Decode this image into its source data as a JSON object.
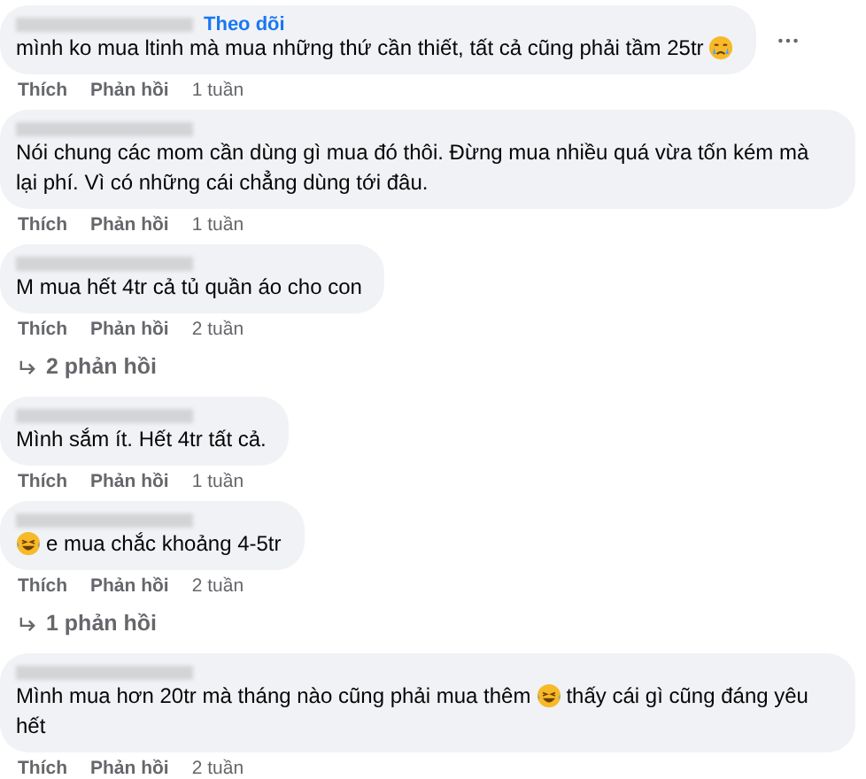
{
  "comments": [
    {
      "follow": "Theo dõi",
      "segments": [
        {
          "kind": "text",
          "text": "mình ko mua ltinh mà mua những thứ cần thiết, tất cả cũng phải tầm 25tr"
        },
        {
          "kind": "crying-emoji"
        }
      ],
      "more_menu": true,
      "actions": [
        "Thích",
        "Phản hồi"
      ],
      "time": "1 tuần"
    },
    {
      "segments": [
        {
          "kind": "text",
          "text": "Nói chung các mom cần dùng gì mua đó thôi. Đừng mua nhiều quá vừa tốn kém mà lại phí. Vì có những cái chẳng dùng tới đâu."
        }
      ],
      "actions": [
        "Thích",
        "Phản hồi"
      ],
      "time": "1 tuần"
    },
    {
      "segments": [
        {
          "kind": "text",
          "text": "M mua hết 4tr cả tủ quần áo cho con"
        }
      ],
      "actions": [
        "Thích",
        "Phản hồi"
      ],
      "time": "2 tuần",
      "replies": "2 phản hồi"
    },
    {
      "segments": [
        {
          "kind": "text",
          "text": "Mình sắm ít. Hết 4tr tất cả."
        }
      ],
      "actions": [
        "Thích",
        "Phản hồi"
      ],
      "time": "1 tuần"
    },
    {
      "segments": [
        {
          "kind": "laughing-emoji"
        },
        {
          "kind": "text",
          "text": "e mua chắc khoảng 4-5tr"
        }
      ],
      "actions": [
        "Thích",
        "Phản hồi"
      ],
      "time": "2 tuần",
      "replies": "1 phản hồi"
    },
    {
      "segments": [
        {
          "kind": "text",
          "text": "Mình mua hơn 20tr mà tháng nào cũng phải mua thêm"
        },
        {
          "kind": "laughing-emoji"
        },
        {
          "kind": "text",
          "text": "thấy cái gì cũng đáng yêu"
        },
        {
          "kind": "text",
          "text": "hết"
        }
      ],
      "actions": [
        "Thích",
        "Phản hồi"
      ],
      "time": "2 tuần"
    }
  ]
}
